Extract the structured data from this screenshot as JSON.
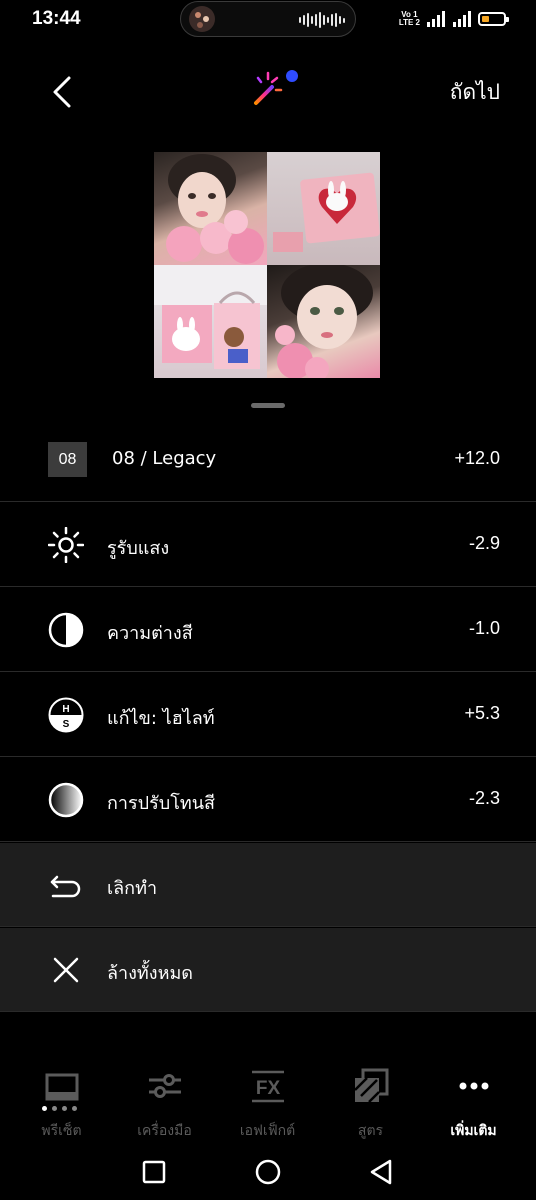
{
  "status_bar": {
    "time": "13:44",
    "network_line1": "Vo 1",
    "network_line2": "LTE 2",
    "battery_level": 0.35,
    "battery_color": "#f5a623"
  },
  "header": {
    "back_icon": "chevron-left-icon",
    "center_icon": "magic-wand-icon",
    "next_label": "ถัดไป"
  },
  "adjustments": [
    {
      "id": "preset",
      "badge": "08",
      "label": "08 / Legacy",
      "value": "+12.0"
    },
    {
      "id": "exposure",
      "icon": "sun-icon",
      "label": "รูรับแสง",
      "value": "-2.9"
    },
    {
      "id": "contrast",
      "icon": "contrast-icon",
      "label": "ความต่างสี",
      "value": "-1.0"
    },
    {
      "id": "highlight",
      "icon": "hs-icon",
      "label": "แก้ไข: ไฮไลท์",
      "value": "+5.3"
    },
    {
      "id": "tone",
      "icon": "tone-icon",
      "label": "การปรับโทนสี",
      "value": "-2.3"
    }
  ],
  "actions": [
    {
      "id": "undo",
      "icon": "undo-icon",
      "label": "เลิกทำ"
    },
    {
      "id": "clear",
      "icon": "close-icon",
      "label": "ล้างทั้งหมด"
    }
  ],
  "tabs": [
    {
      "id": "presets",
      "icon": "presets-icon",
      "label": "พรีเซ็ต"
    },
    {
      "id": "tools",
      "icon": "sliders-icon",
      "label": "เครื่องมือ"
    },
    {
      "id": "effects",
      "icon": "fx-icon",
      "label": "เอฟเฟ็กต์"
    },
    {
      "id": "recipes",
      "icon": "recipes-icon",
      "label": "สูตร"
    },
    {
      "id": "more",
      "icon": "more-icon",
      "label": "เพิ่มเติม",
      "active": true
    }
  ],
  "colors": {
    "background": "#000000",
    "action_row": "#1e1e1e",
    "inactive_tab": "#5b5b5b",
    "accent_blue": "#2f4cff",
    "accent_pink": "#ff3db5"
  }
}
